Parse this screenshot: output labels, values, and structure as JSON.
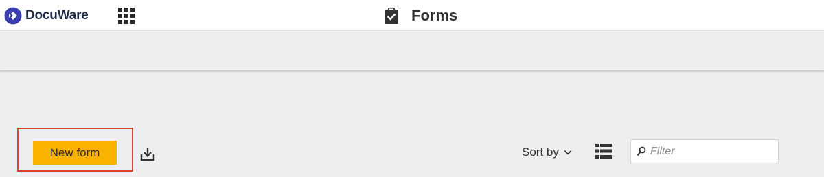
{
  "header": {
    "brand": "DocuWare",
    "page_title": "Forms"
  },
  "toolbar": {
    "new_form_label": "New form",
    "sort_label": "Sort by",
    "filter_placeholder": "Filter"
  },
  "colors": {
    "accent": "#f9b200",
    "highlight_border": "#d9472b",
    "brand": "#3a3fb0"
  },
  "icons": [
    "docuware-logo-icon",
    "apps-grid-icon",
    "clipboard-check-icon",
    "download-icon",
    "chevron-down-icon",
    "list-view-icon",
    "search-icon"
  ]
}
